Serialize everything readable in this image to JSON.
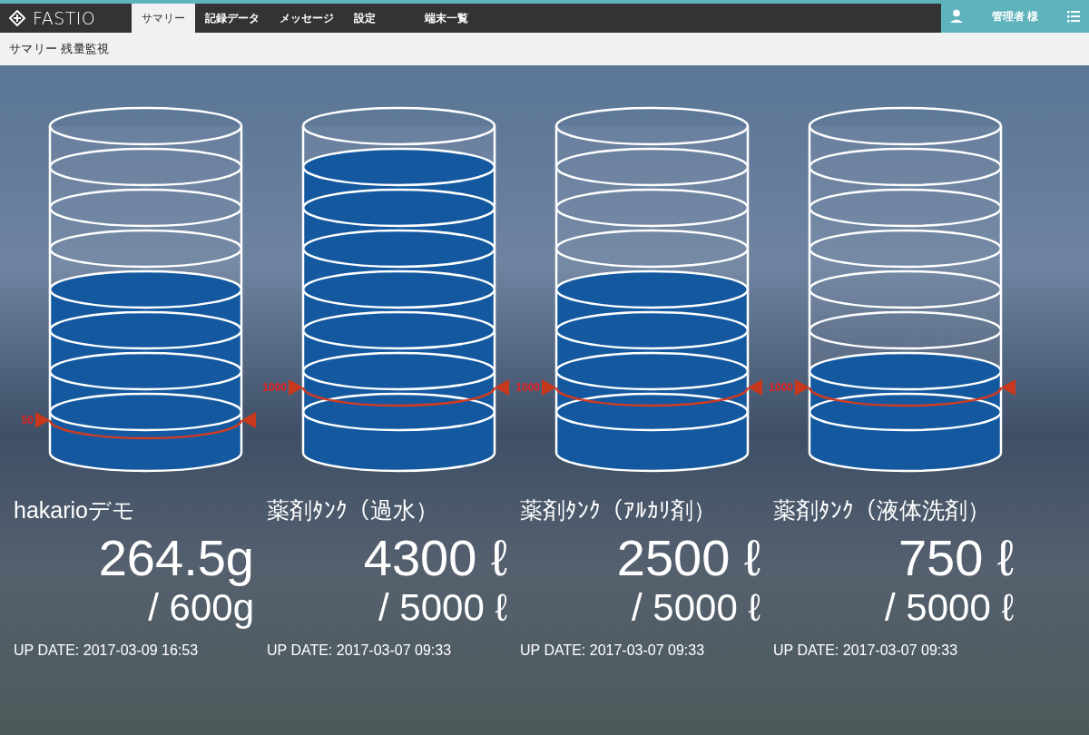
{
  "header": {
    "logo": "FASTIO",
    "tabs": [
      {
        "label": "サマリー",
        "selected": true
      },
      {
        "label": "記録データ",
        "selected": false
      },
      {
        "label": "メッセージ",
        "selected": false
      },
      {
        "label": "設定",
        "selected": false
      },
      {
        "label": "端末一覧",
        "selected": false
      }
    ],
    "user": "管理者 様"
  },
  "breadcrumb": "サマリー 残量監視",
  "tanks": [
    {
      "name": "hakarioデモ",
      "level": 0.5,
      "threshold": {
        "label": "50",
        "level": 0.1
      },
      "value": "264.5g",
      "capacity": "/ 600g",
      "updated": "UP DATE: 2017-03-09 16:53"
    },
    {
      "name": "薬剤ﾀﾝｸ（過水）",
      "level": 0.875,
      "threshold": {
        "label": "1000",
        "level": 0.2
      },
      "value": "4300 ℓ",
      "capacity": "/ 5000 ℓ",
      "updated": "UP DATE: 2017-03-07 09:33"
    },
    {
      "name": "薬剤ﾀﾝｸ（ｱﾙｶﾘ剤）",
      "level": 0.5,
      "threshold": {
        "label": "1000",
        "level": 0.2
      },
      "value": "2500 ℓ",
      "capacity": "/ 5000 ℓ",
      "updated": "UP DATE: 2017-03-07 09:33"
    },
    {
      "name": "薬剤ﾀﾝｸ（液体洗剤）",
      "level": 0.25,
      "threshold": {
        "label": "1000",
        "level": 0.2
      },
      "value": "750 ℓ",
      "capacity": "/ 5000 ℓ",
      "updated": "UP DATE: 2017-03-07 09:33"
    }
  ]
}
